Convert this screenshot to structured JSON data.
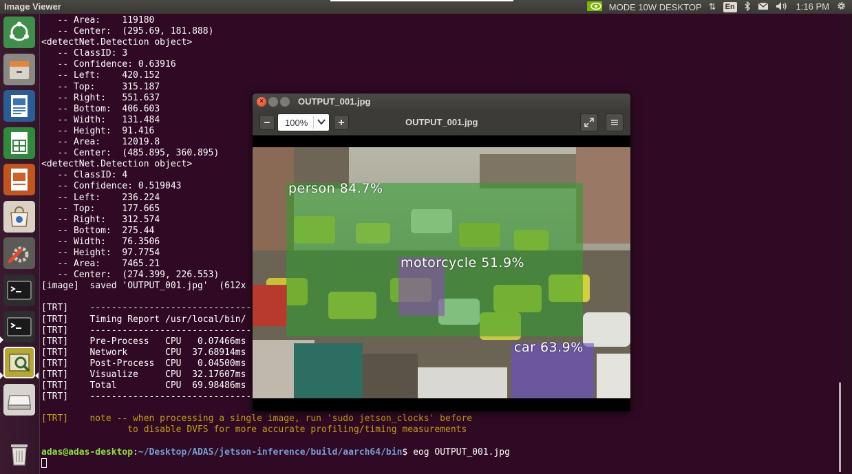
{
  "topbar": {
    "app_title": "Image Viewer",
    "mode": "MODE 10W DESKTOP",
    "keyboard": "En",
    "time": "1:16 PM"
  },
  "launcher": {
    "items": [
      {
        "name": "dash-home-icon"
      },
      {
        "name": "files-icon"
      },
      {
        "name": "libreoffice-writer-icon"
      },
      {
        "name": "libreoffice-calc-icon"
      },
      {
        "name": "libreoffice-impress-icon"
      },
      {
        "name": "software-center-icon"
      },
      {
        "name": "system-settings-icon"
      },
      {
        "name": "terminal-icon"
      },
      {
        "name": "terminal-icon"
      },
      {
        "name": "image-viewer-icon"
      },
      {
        "name": "drive-icon"
      },
      {
        "name": "trash-icon"
      }
    ]
  },
  "terminal": {
    "lines": [
      "   -- Area:    119180",
      "   -- Center:  (295.69, 181.888)",
      "<detectNet.Detection object>",
      "   -- ClassID: 3",
      "   -- Confidence: 0.63916",
      "   -- Left:    420.152",
      "   -- Top:     315.187",
      "   -- Right:   551.637",
      "   -- Bottom:  406.603",
      "   -- Width:   131.484",
      "   -- Height:  91.416",
      "   -- Area:    12019.8",
      "   -- Center:  (485.895, 360.895)",
      "<detectNet.Detection object>",
      "   -- ClassID: 4",
      "   -- Confidence: 0.519043",
      "   -- Left:    236.224",
      "   -- Top:     177.665",
      "   -- Right:   312.574",
      "   -- Bottom:  275.44",
      "   -- Width:   76.3506",
      "   -- Height:  97.7754",
      "   -- Area:    7465.21",
      "   -- Center:  (274.399, 226.553)",
      "[image]  saved 'OUTPUT_001.jpg'  (612x",
      "",
      "[TRT]    ----------------------------------",
      "[TRT]    Timing Report /usr/local/bin/",
      "[TRT]    ----------------------------------",
      "[TRT]    Pre-Process   CPU   0.07466ms",
      "[TRT]    Network       CPU  37.68914ms",
      "[TRT]    Post-Process  CPU   0.04500ms",
      "[TRT]    Visualize     CPU  32.17607ms",
      "[TRT]    Total         CPU  69.98486ms",
      "[TRT]    ----------------------------------",
      ""
    ],
    "warn_lines": [
      "[TRT]    note -- when processing a single image, run 'sudo jetson_clocks' before",
      "                to disable DVFS for more accurate profiling/timing measurements"
    ],
    "prompt_user": "adas@adas-desktop",
    "prompt_sep": ":",
    "prompt_path": "~/Desktop/ADAS/jetson-inference/build/aarch64/bin",
    "prompt_symbol": "$ ",
    "command": "eog OUTPUT_001.jpg"
  },
  "viewer": {
    "window_title": "OUTPUT_001.jpg",
    "zoom": "100%",
    "filename": "OUTPUT_001.jpg",
    "detections": [
      {
        "label": "person 84.7%",
        "color": "#2e9e2e"
      },
      {
        "label": "motorcycle 51.9%",
        "color": "#8a4fb0"
      },
      {
        "label": "car 63.9%",
        "color": "#6a4fd0"
      }
    ]
  }
}
